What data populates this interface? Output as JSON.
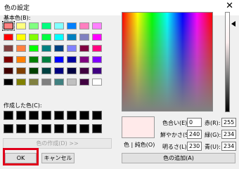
{
  "window": {
    "title": "色の設定",
    "close_glyph": "✕"
  },
  "basic": {
    "label": "基本色(B):",
    "colors": [
      "#ff8080",
      "#ffff80",
      "#80ff80",
      "#00ff80",
      "#80ffff",
      "#0080ff",
      "#ff80c0",
      "#ff80ff",
      "#ff0000",
      "#ffff00",
      "#80ff00",
      "#00ff40",
      "#00ffff",
      "#0080c0",
      "#8080c0",
      "#ff00ff",
      "#804040",
      "#ff8040",
      "#00ff00",
      "#008080",
      "#004080",
      "#8080ff",
      "#800040",
      "#ff0080",
      "#800000",
      "#ff8000",
      "#008000",
      "#008040",
      "#0000ff",
      "#0000a0",
      "#800080",
      "#8000ff",
      "#400000",
      "#804000",
      "#004000",
      "#004040",
      "#000080",
      "#000040",
      "#400040",
      "#400080",
      "#000000",
      "#808000",
      "#808040",
      "#808080",
      "#408080",
      "#c0c0c0",
      "#400040",
      "#ffffff"
    ]
  },
  "custom": {
    "label": "作成した色(C):",
    "count": 16
  },
  "buttons": {
    "define": "色の作成(D) >>",
    "ok": "OK",
    "cancel": "キャンセル",
    "add": "色の追加(A)"
  },
  "preview": {
    "label": "色 | 純色(O)"
  },
  "fields": {
    "hue_label": "色合い(E):",
    "hue": "0",
    "sat_label": "鮮やかさ(S):",
    "sat": "240",
    "lum_label": "明るさ(L):",
    "lum": "230",
    "red_label": "赤(R):",
    "red": "255",
    "green_label": "緑(G):",
    "green": "234",
    "blue_label": "青(U):",
    "blue": "234"
  }
}
